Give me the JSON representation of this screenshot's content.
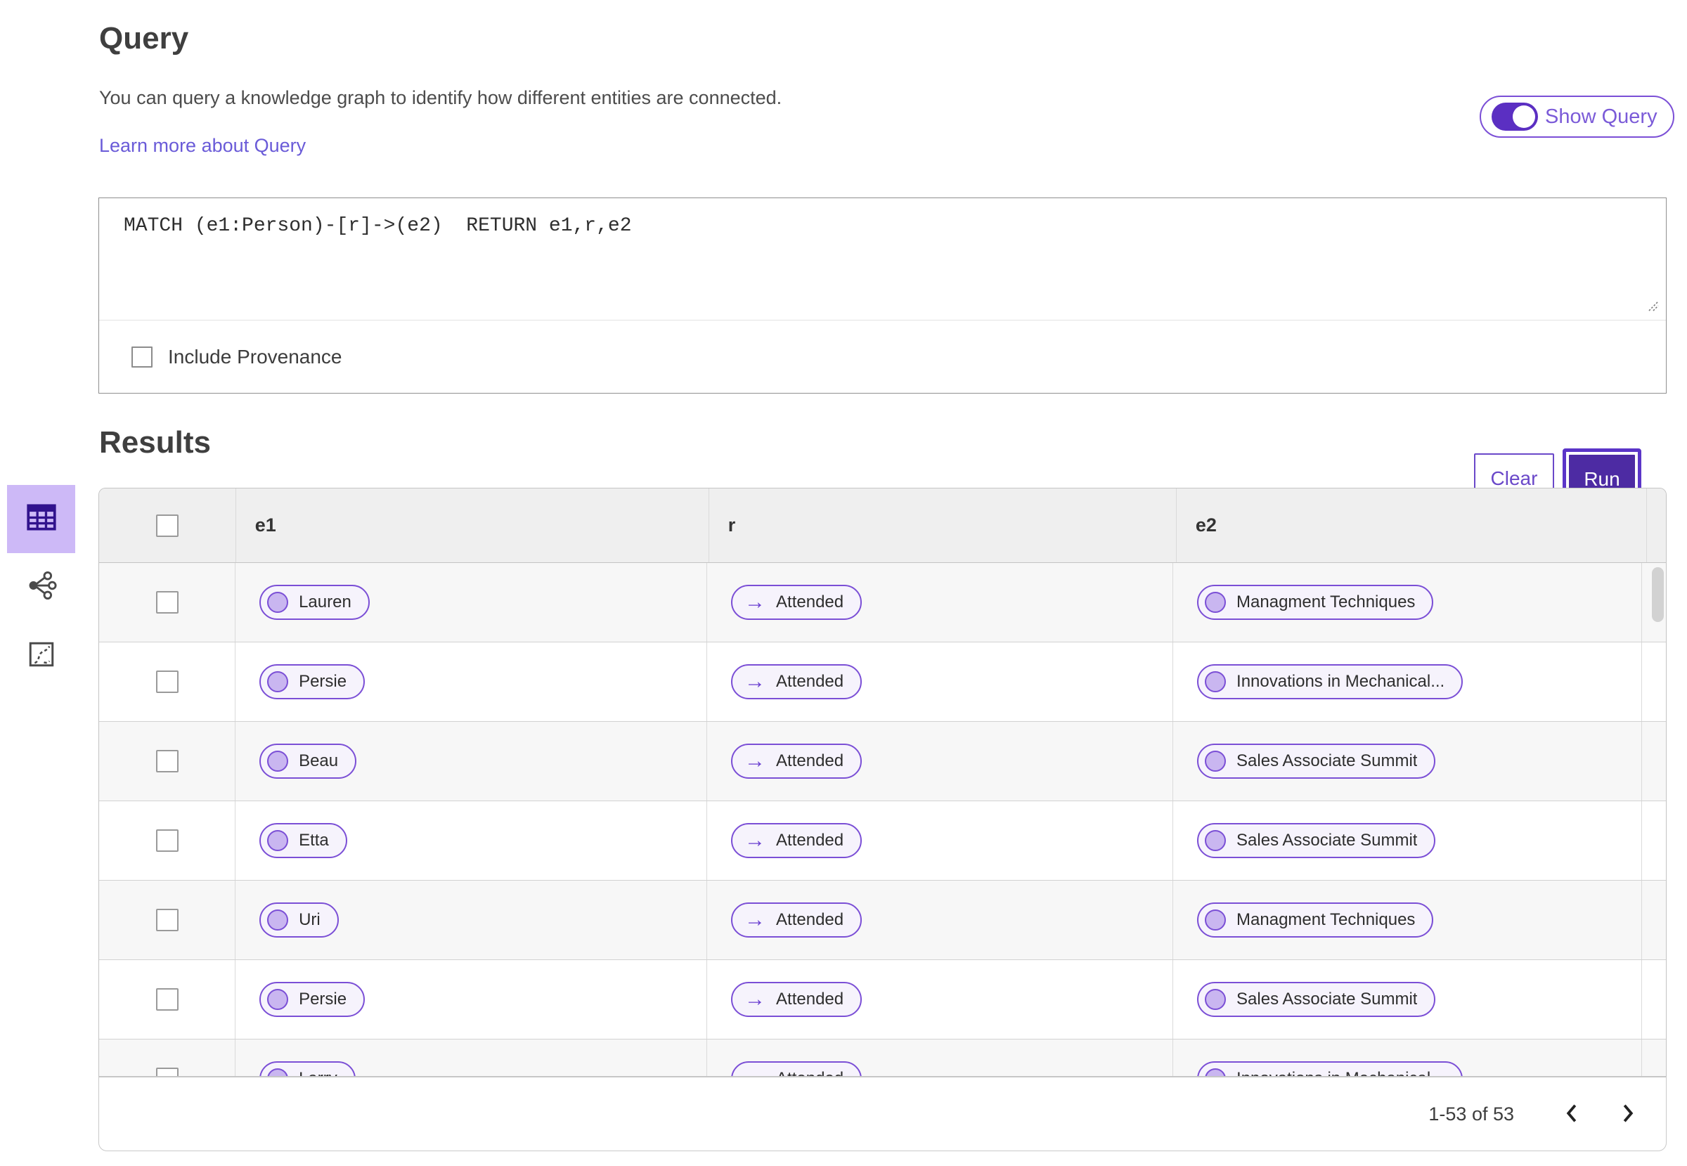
{
  "colors": {
    "accent_purple": "#5B2FC2",
    "run_button_fill": "#4D2BA3",
    "pill_border": "#7B4FD6",
    "pill_fill": "#F6F3FC",
    "pill_circle": "#C9B6F0",
    "link": "#6A5BD8",
    "selected_view_bg": "#CDB9F7",
    "table_header_bg": "#EFEFEF",
    "row_stripe": "#F7F7F7"
  },
  "query_section": {
    "title": "Query",
    "description": "You can query a knowledge graph to identify how different entities are connected.",
    "learn_more_link": "Learn more about Query",
    "show_query_toggle": {
      "label": "Show Query",
      "state": "on"
    },
    "query_input": {
      "value": "MATCH (e1:Person)-[r]->(e2)  RETURN e1,r,e2"
    },
    "include_provenance": {
      "label": "Include Provenance",
      "checked": false
    },
    "clear_button": "Clear",
    "run_button": "Run"
  },
  "results_section": {
    "title": "Results",
    "view_rail": [
      {
        "icon": "table-view-icon",
        "selected": true
      },
      {
        "icon": "network-view-icon",
        "selected": false
      },
      {
        "icon": "chart-view-icon",
        "selected": false
      }
    ],
    "table": {
      "columns": [
        "e1",
        "r",
        "e2"
      ],
      "relation_arrow_icon": "→",
      "rows": [
        {
          "e1": "Lauren",
          "r": "Attended",
          "e2": "Managment Techniques"
        },
        {
          "e1": "Persie",
          "r": "Attended",
          "e2": "Innovations in Mechanical..."
        },
        {
          "e1": "Beau",
          "r": "Attended",
          "e2": "Sales Associate Summit"
        },
        {
          "e1": "Etta",
          "r": "Attended",
          "e2": "Sales Associate Summit"
        },
        {
          "e1": "Uri",
          "r": "Attended",
          "e2": "Managment Techniques"
        },
        {
          "e1": "Persie",
          "r": "Attended",
          "e2": "Sales Associate Summit"
        },
        {
          "e1": "Larry",
          "r": "Attended",
          "e2": "Innovations in Mechanical..."
        }
      ]
    },
    "pagination": {
      "range_label": "1-53 of 53"
    }
  }
}
